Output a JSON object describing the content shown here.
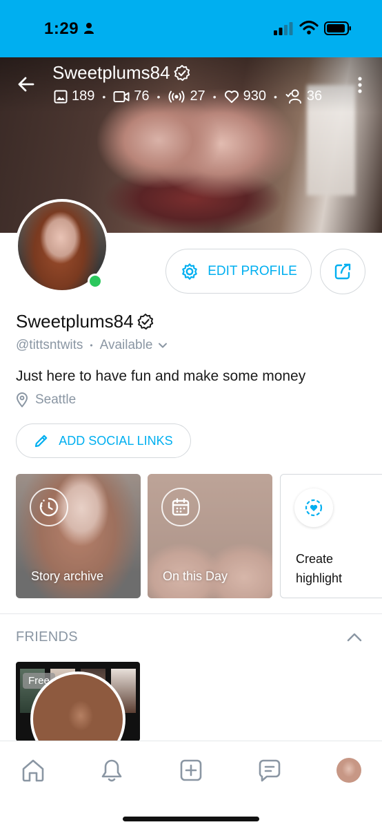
{
  "status_bar": {
    "time": "1:29"
  },
  "header": {
    "display_name": "Sweetplums84",
    "stats": {
      "photos": "189",
      "videos": "76",
      "streams": "27",
      "likes": "930",
      "fans": "36"
    },
    "stat_separator": "•"
  },
  "profile": {
    "edit_label": "EDIT PROFILE",
    "name": "Sweetplums84",
    "handle": "@tittsntwits",
    "separator": "•",
    "availability": "Available",
    "bio": "Just here to have fun and make some money",
    "location": "Seattle",
    "social_links_label": "ADD SOCIAL LINKS"
  },
  "highlights": [
    {
      "label": "Story archive",
      "icon": "clock-icon"
    },
    {
      "label": "On this Day",
      "icon": "calendar-icon"
    },
    {
      "label": "Create highlight",
      "label_line1": "Create",
      "label_line2": "highlight",
      "icon": "heart-circle-icon"
    }
  ],
  "friends": {
    "title": "FRIENDS",
    "items": [
      {
        "badge": "Free"
      }
    ]
  },
  "nav": [
    "home-icon",
    "bell-icon",
    "plus-square-icon",
    "chat-icon",
    "avatar"
  ],
  "colors": {
    "accent": "#00aff0",
    "muted": "#8a96a3",
    "online": "#2bc75c"
  }
}
